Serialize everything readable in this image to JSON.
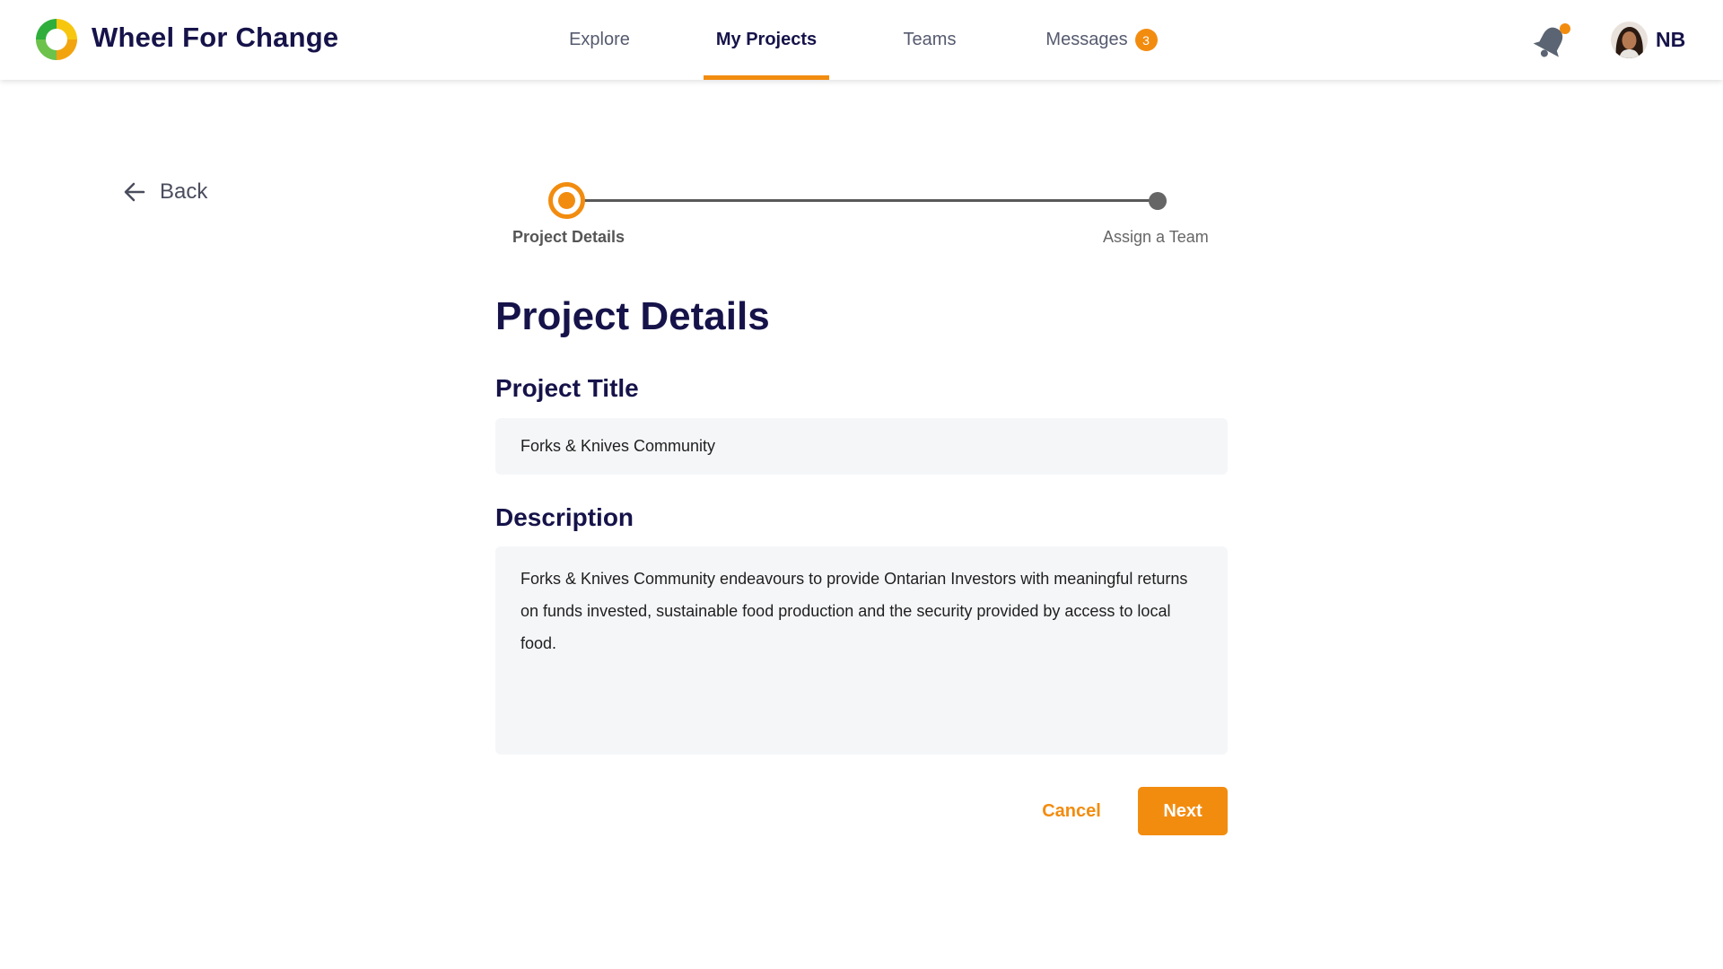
{
  "app": {
    "brand": "Wheel For Change",
    "logo_icon": "green-yellow-ring-logo"
  },
  "nav": {
    "items": [
      {
        "label": "Explore",
        "active": false
      },
      {
        "label": "My Projects",
        "active": true
      },
      {
        "label": "Teams",
        "active": false
      },
      {
        "label": "Messages",
        "active": false,
        "badge": "3"
      }
    ]
  },
  "user": {
    "initials": "NB",
    "notification_icon": "bell-icon",
    "has_unread_notification": true
  },
  "back": {
    "label": "Back",
    "icon": "arrow-left-icon"
  },
  "stepper": {
    "steps": [
      {
        "label": "Project Details",
        "state": "active"
      },
      {
        "label": "Assign a Team",
        "state": "upcoming"
      }
    ]
  },
  "form": {
    "heading": "Project Details",
    "title_label": "Project Title",
    "title_value": "Forks & Knives Community",
    "description_label": "Description",
    "description_value": "Forks & Knives Community endeavours to provide Ontarian Investors with meaningful returns on funds invested, sustainable food production and the security provided by access to local food.",
    "cancel_label": "Cancel",
    "next_label": "Next"
  },
  "colors": {
    "accent": "#f28c0f",
    "primary_text": "#16134a",
    "input_background": "#f5f6f8"
  }
}
